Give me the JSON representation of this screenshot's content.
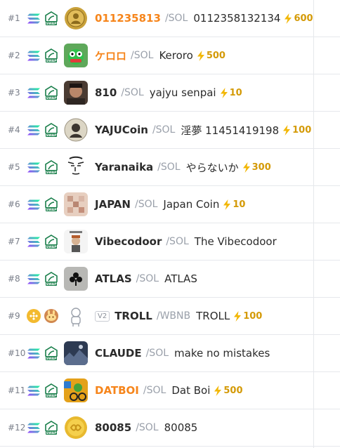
{
  "colors": {
    "accent_orange": "#f6851b",
    "boost_gold": "#d49a07",
    "muted": "#9aa0aa"
  },
  "rows": [
    {
      "rank": "#1",
      "chain": "solana-icon",
      "dex": "raydium-swap-icon",
      "avatar": "coin-avatar",
      "symbol": "011235813",
      "symbol_color": "orange",
      "quote": "/SOL",
      "name": "0112358132134",
      "boost": "600"
    },
    {
      "rank": "#2",
      "chain": "solana-icon",
      "dex": "raydium-swap-icon",
      "avatar": "frog-avatar",
      "symbol": "ケロロ",
      "symbol_color": "orange",
      "quote": "/SOL",
      "name": "Keroro",
      "boost": "500"
    },
    {
      "rank": "#3",
      "chain": "solana-icon",
      "dex": "raydium-swap-icon",
      "avatar": "man-photo-avatar",
      "symbol": "810",
      "symbol_color": "dark",
      "quote": "/SOL",
      "name": "yajyu senpai",
      "boost": "10"
    },
    {
      "rank": "#4",
      "chain": "solana-icon",
      "dex": "raydium-swap-icon",
      "avatar": "coin-portrait-avatar",
      "symbol": "YAJUCoin",
      "symbol_color": "dark",
      "quote": "/SOL",
      "name": "淫夢 11451419198",
      "boost": "100"
    },
    {
      "rank": "#5",
      "chain": "solana-icon",
      "dex": "raydium-swap-icon",
      "avatar": "sketch-face-avatar",
      "symbol": "Yaranaika",
      "symbol_color": "dark",
      "quote": "/SOL",
      "name": "やらないか",
      "boost": "300"
    },
    {
      "rank": "#6",
      "chain": "solana-icon",
      "dex": "raydium-swap-icon",
      "avatar": "blurred-avatar",
      "symbol": "JAPAN",
      "symbol_color": "dark",
      "quote": "/SOL",
      "name": "Japan Coin",
      "boost": "10"
    },
    {
      "rank": "#7",
      "chain": "solana-icon",
      "dex": "raydium-swap-icon",
      "avatar": "character-avatar",
      "symbol": "Vibecodoor",
      "symbol_color": "dark",
      "quote": "/SOL",
      "name": "The Vibecodoor",
      "boost": ""
    },
    {
      "rank": "#8",
      "chain": "solana-icon",
      "dex": "raydium-swap-icon",
      "avatar": "club-avatar",
      "symbol": "ATLAS",
      "symbol_color": "dark",
      "quote": "/SOL",
      "name": "ATLAS",
      "boost": ""
    },
    {
      "rank": "#9",
      "chain": "bnb-icon",
      "dex": "pancakeswap-icon",
      "avatar": "troll-avatar",
      "version": "V2",
      "symbol": "TROLL",
      "symbol_color": "dark",
      "quote": "/WBNB",
      "name": "TROLL",
      "boost": "100"
    },
    {
      "rank": "#10",
      "chain": "solana-icon",
      "dex": "raydium-swap-icon",
      "avatar": "landscape-avatar",
      "symbol": "CLAUDE",
      "symbol_color": "dark",
      "quote": "/SOL",
      "name": "make no mistakes",
      "boost": ""
    },
    {
      "rank": "#11",
      "chain": "solana-icon",
      "dex": "raydium-swap-icon",
      "avatar": "frog-bike-avatar",
      "symbol": "DATBOI",
      "symbol_color": "orange",
      "quote": "/SOL",
      "name": "Dat Boi",
      "boost": "500"
    },
    {
      "rank": "#12",
      "chain": "solana-icon",
      "dex": "raydium-swap-icon",
      "avatar": "gold-coin-avatar",
      "symbol": "80085",
      "symbol_color": "dark",
      "quote": "/SOL",
      "name": "80085",
      "boost": ""
    }
  ]
}
